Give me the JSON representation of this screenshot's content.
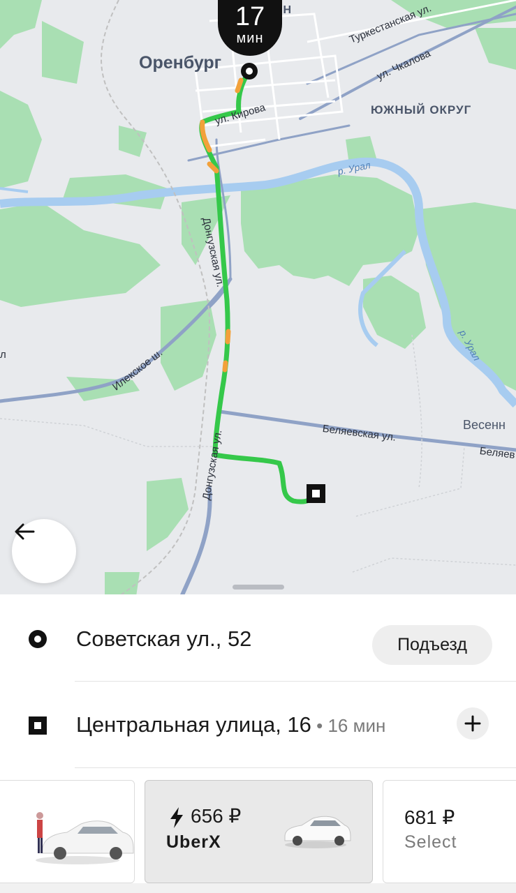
{
  "map": {
    "city": "Оренбург",
    "district_partial": "ОН",
    "district": "ЮЖНЫЙ ОКРУГ",
    "streets": {
      "turkestanskaya": "Туркестанская ул.",
      "chkalova": "ул. Чкалова",
      "kirova": "ул. Кирова",
      "ural1": "р. Урал",
      "ural2": "р. Урал",
      "donguzskaya1": "Донгузская ул.",
      "donguzskaya2": "Донгузская ул.",
      "ilekskoe": "Илекское ш.",
      "belyaevskaya": "Беляевская ул.",
      "belyaevskaya_partial": "Беляев",
      "vesennee_partial": "Весенн",
      "edge_partial": "л"
    },
    "eta": {
      "value": "17",
      "unit": "мин"
    }
  },
  "trip": {
    "pickup": {
      "address": "Советская ул., 52",
      "action_label": "Подъезд"
    },
    "destination": {
      "address": "Центральная улица, 16",
      "eta_text": " • 16 мин"
    }
  },
  "products": [
    {
      "id": "partial",
      "price": "",
      "name": ""
    },
    {
      "id": "uberx",
      "price": "656 ₽",
      "name": "UberX",
      "surge_icon": "lightning-icon",
      "selected": true
    },
    {
      "id": "select",
      "price": "681 ₽",
      "name": "Select"
    }
  ],
  "colors": {
    "route_green": "#35c84a",
    "route_orange": "#f2a13a",
    "park": "#a9dfb3",
    "water": "#a7ccf0",
    "road": "#8fa2c6"
  }
}
